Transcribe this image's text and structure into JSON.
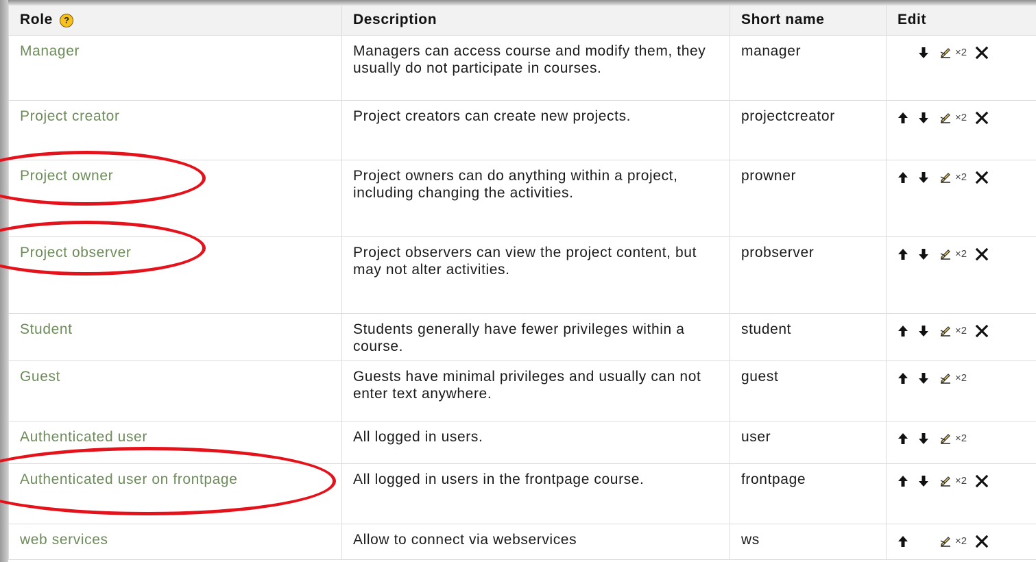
{
  "header": {
    "role": "Role",
    "help_icon": "?",
    "description": "Description",
    "short_name": "Short name",
    "edit": "Edit"
  },
  "rows": [
    {
      "role": "Manager",
      "description": "Managers can access course and modify them, they usually do not participate in courses.",
      "short": "manager",
      "up": false,
      "down": true,
      "assign": "×2",
      "delete": true
    },
    {
      "role": "Project creator",
      "description": "Project creators can create new projects.",
      "short": "projectcreator",
      "up": true,
      "down": true,
      "assign": "×2",
      "delete": true
    },
    {
      "role": "Project owner",
      "description": "Project owners can do anything within a project, including changing the activities.",
      "short": "prowner",
      "up": true,
      "down": true,
      "assign": "×2",
      "delete": true
    },
    {
      "role": "Project observer",
      "description": "Project observers can view the project content, but may not alter activities.",
      "short": "probserver",
      "up": true,
      "down": true,
      "assign": "×2",
      "delete": true
    },
    {
      "role": "Student",
      "description": "Students generally have fewer privileges within a course.",
      "short": "student",
      "up": true,
      "down": true,
      "assign": "×2",
      "delete": true
    },
    {
      "role": "Guest",
      "description": "Guests have minimal privileges and usually can not enter text anywhere.",
      "short": "guest",
      "up": true,
      "down": true,
      "assign": "×2",
      "delete": false
    },
    {
      "role": "Authenticated user",
      "description": "All logged in users.",
      "short": "user",
      "up": true,
      "down": true,
      "assign": "×2",
      "delete": false
    },
    {
      "role": "Authenticated user on frontpage",
      "description": "All logged in users in the frontpage course.",
      "short": "frontpage",
      "up": true,
      "down": true,
      "assign": "×2",
      "delete": true
    },
    {
      "role": "web services",
      "description": "Allow to connect via webservices",
      "short": "ws",
      "up": true,
      "down": false,
      "assign": "×2",
      "delete": true
    }
  ],
  "icons": {
    "up": "arrow-up-icon",
    "down": "arrow-down-icon",
    "assign": "assign-pencil-icon",
    "delete": "delete-x-icon",
    "help": "help-icon"
  },
  "colors": {
    "role_link": "#6d8c5a",
    "highlight": "#e4121b",
    "help_badge": "#f7c21e",
    "header_bg": "#f2f2f2"
  },
  "highlighted_roles": [
    "Project owner",
    "Project observer",
    "Authenticated user on frontpage"
  ]
}
